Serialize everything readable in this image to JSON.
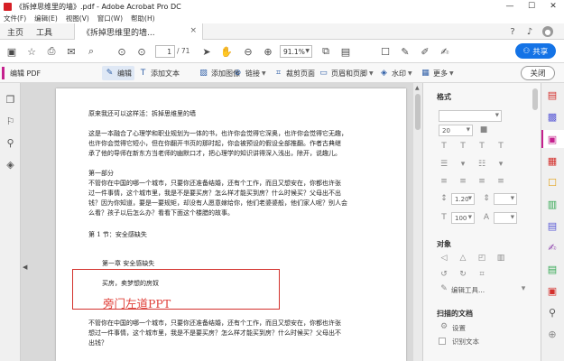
{
  "window": {
    "title": "《拆掉思维里的墙》.pdf - Adobe Acrobat Pro DC",
    "controls": {
      "minimize": "—",
      "maximize": "☐",
      "close": "✕"
    }
  },
  "menu": [
    "文件(F)",
    "编辑(E)",
    "视图(V)",
    "窗口(W)",
    "帮助(H)"
  ],
  "tabs": {
    "home": "主页",
    "tools": "工具",
    "document": "《拆掉思维里的墙...",
    "close": "×"
  },
  "toolbar": {
    "page_current": "1",
    "page_total": "/ 71",
    "zoom": "91.1%",
    "share": "共享"
  },
  "editbar": {
    "title": "编辑 PDF",
    "items": [
      "编辑",
      "添加文本",
      "添加图像",
      "链接",
      "裁剪页面",
      "页眉和页脚",
      "水印",
      "更多"
    ],
    "close": "关闭"
  },
  "document": {
    "lines": [
      "原来我还可以这样活：拆掉思维里的墙",
      "这是一本融合了心理学和职业规划为一体的书，也许你会觉得它深奥，也许你会觉得它无趣，",
      "也许你会觉得它短小，但在你翻开书页的那时起，你会被预设的假设全部推翻。作者古典继",
      "承了他的导师在新东方当老师的幽默口才，把心理学的知识讲得深入浅出，除开，说趣儿。",
      "第一部分",
      "不管你在中国的哪一个城市，只要你还准备结婚，还有个工作，而且又想安在，你都也许张",
      "过一件事情，这个城市里，我是不是要买房？怎么样才能买到房？什么时候买？父母出不出",
      "钱？因为你知道，要是一要规矩，却没有人愿意嫁给你，他们老婆婆般，他们家人呢？别人会",
      "么看？孩子以后怎么办？看看下面这个楼腊的故事。",
      "第 1 节：安全感缺失",
      "第一章 安全感缺失",
      "买房，卖梦想的房奴",
      "不管你在中国的哪一个城市，只要你还准备结婚，还有个工作，而且又想安在，你都也许张",
      "想过一件事情，这个城市里，我是不是要买房？怎么样才能买到房？什么时候买？父母出不",
      "出钱？"
    ],
    "watermark": "旁门左道PPT"
  },
  "panel": {
    "format_title": "格式",
    "font_size": "20",
    "line_spacing": "1.20",
    "scale": "100",
    "object_title": "对象",
    "edit_tool": "编辑工具...",
    "scan_title": "扫描的文档",
    "settings": "设置",
    "recognize": "识别文本"
  },
  "colors": {
    "accent": "#1473e6",
    "edit_pink": "#c5218e",
    "watermark_red": "#e0403a"
  }
}
